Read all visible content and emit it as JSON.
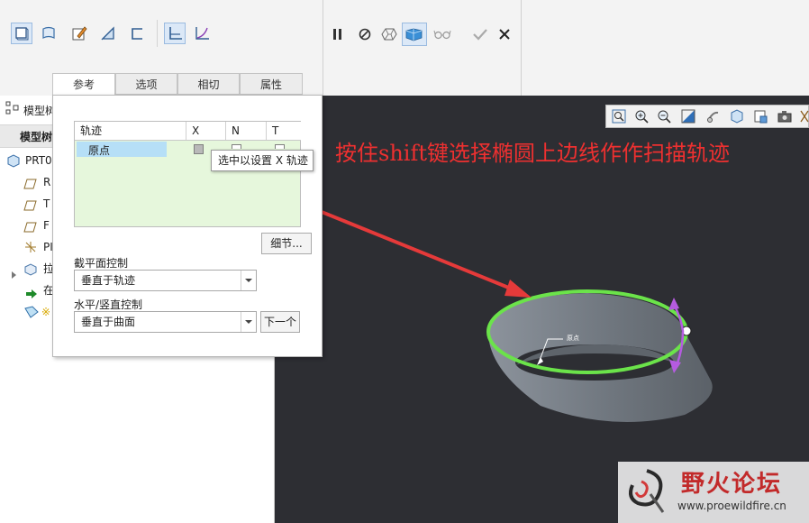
{
  "tabs": [
    "参考",
    "选项",
    "相切",
    "属性"
  ],
  "tree": {
    "header_short": "模型树",
    "header_tab": "模型树",
    "rows": [
      "PRT0",
      "R",
      "T",
      "F",
      "PI",
      "拉",
      "在",
      "※"
    ]
  },
  "panel": {
    "traj_header": [
      "轨迹",
      "X",
      "N",
      "T"
    ],
    "traj_row": "原点",
    "details_btn": "细节...",
    "section_label": "截平面控制",
    "section_value": "垂直于轨迹",
    "hv_label": "水平/竖直控制",
    "hv_value": "垂直于曲面",
    "next_btn": "下一个"
  },
  "tooltip": "选中以设置 X 轨迹",
  "annotation": "按住shift键选择椭圆上边线作作扫描轨迹",
  "model_label": "原点",
  "watermark": {
    "title": "野火论坛",
    "url": "www.proewildfire.cn"
  },
  "icons": {
    "ribbon_left": [
      "solid-icon",
      "surface-icon",
      "sketch-icon",
      "thicken-icon",
      "open-section-icon",
      "const-section-icon",
      "variable-section-icon"
    ],
    "ribbon_mid": [
      "pause-icon",
      "stop-icon",
      "preview-off-icon",
      "preview-icon",
      "glasses-icon",
      "ok-icon",
      "cancel-icon"
    ],
    "view": [
      "zoom-fit-icon",
      "zoom-in-icon",
      "zoom-out-icon",
      "repaint-icon",
      "spin-icon",
      "display-style-icon",
      "saved-views-icon",
      "camera-icon",
      "datum-display-icon"
    ]
  },
  "colors": {
    "viewport": "#2d2e33",
    "highlight": "#6be34a",
    "arrow": "#e53a3a",
    "annotation": "#ee3030",
    "direction": "#b55be0"
  }
}
